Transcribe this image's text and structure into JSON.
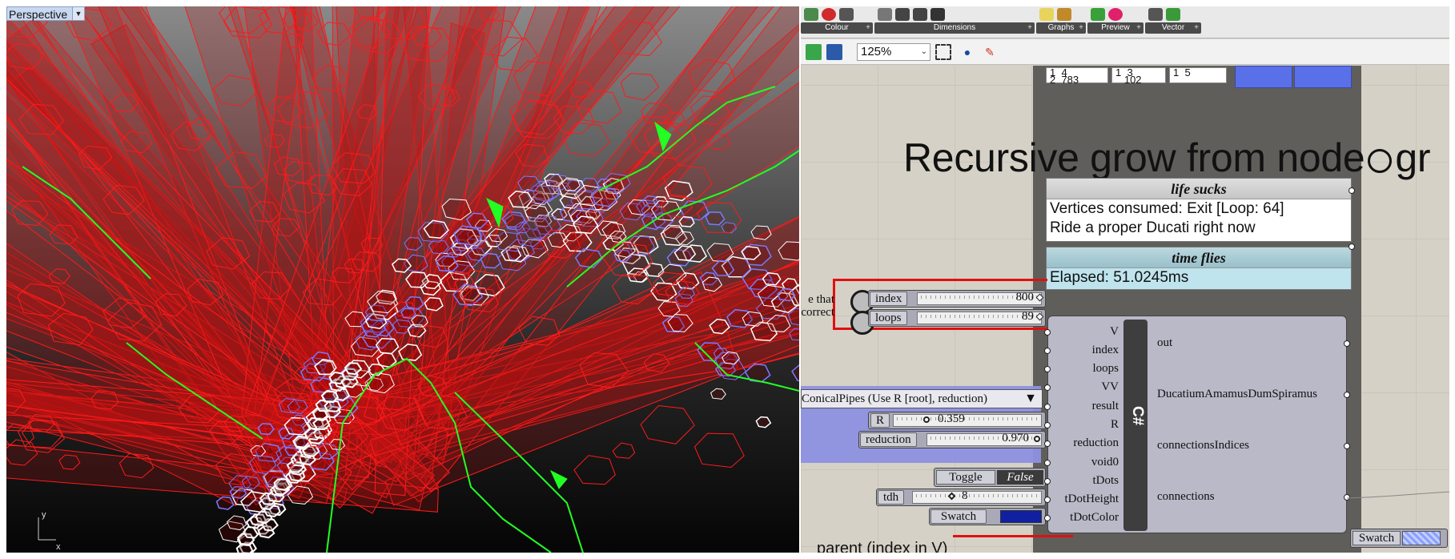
{
  "viewport": {
    "title": "Perspective",
    "menu_caret": "▼",
    "axis_y": "y",
    "axis_x": "x",
    "colors": {
      "tube": "#ff1a1a",
      "mesh": "#ffffff",
      "mesh_edge": "#7a7aff",
      "curve": "#22ff22"
    }
  },
  "ribbon": {
    "groups": [
      {
        "label": "Colour"
      },
      {
        "label": "Dimensions"
      },
      {
        "label": "Graphs"
      },
      {
        "label": "Preview"
      },
      {
        "label": "Vector"
      }
    ],
    "plus": "+"
  },
  "toolbar": {
    "zoom": "125%",
    "zoom_caret": "⌄"
  },
  "top_panels": [
    "1  4\n2  783",
    "1  3\n   102",
    "1  5"
  ],
  "title_text_1": "Recursive grow from node",
  "title_text_2": "gr",
  "panel_life": {
    "title": "life sucks",
    "lines": [
      "Vertices consumed: Exit [Loop: 64]",
      "Ride a proper Ducati right now"
    ]
  },
  "panel_time": {
    "title": "time flies",
    "lines": [
      "Elapsed: 51.0245ms"
    ]
  },
  "note_left": "e that\ncorrect",
  "sliders": {
    "index": {
      "label": "index",
      "value": "800"
    },
    "loops": {
      "label": "loops",
      "value": "89"
    },
    "R": {
      "label": "R",
      "value": "0.359"
    },
    "reduction": {
      "label": "reduction",
      "value": "0.970"
    },
    "tdh": {
      "label": "tdh",
      "value": "8"
    }
  },
  "dropdown": {
    "value": "ConicalPipes (Use R [root], reduction)",
    "arrow": "▼"
  },
  "toggle": {
    "label": "Toggle",
    "value": "False"
  },
  "swatch_left": {
    "label": "Swatch",
    "color": "#1020a0"
  },
  "swatch_right": {
    "label": "Swatch"
  },
  "csharp": {
    "name": "C#",
    "inputs": [
      "V",
      "index",
      "loops",
      "VV",
      "result",
      "R",
      "reduction",
      "void0",
      "tDots",
      "tDotHeight",
      "tDotColor"
    ],
    "outputs": [
      "out",
      "DucatiumAmamusDumSpiramus",
      "connectionsIndices",
      "connections"
    ]
  },
  "parent_label": "parent (index in V)"
}
